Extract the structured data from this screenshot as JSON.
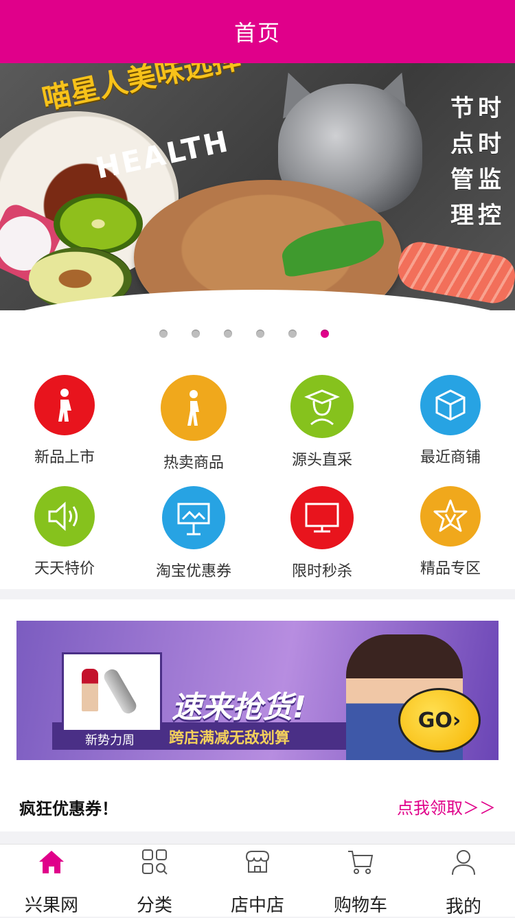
{
  "header": {
    "title": "首页"
  },
  "banner": {
    "headline": "喵星人美味选择",
    "badge": "HEALTH",
    "side_text": [
      "节时",
      "点时",
      "管监",
      "理控"
    ],
    "slide_count": 6,
    "active_slide_index": 5
  },
  "categories": [
    {
      "label": "新品上市",
      "icon": "walking-person-icon",
      "color": "#e8141d"
    },
    {
      "label": "热卖商品",
      "icon": "walking-person-icon",
      "color": "#f0a81c"
    },
    {
      "label": "源头直采",
      "icon": "graduate-icon",
      "color": "#86c21d"
    },
    {
      "label": "最近商铺",
      "icon": "box-icon",
      "color": "#27a3e3"
    },
    {
      "label": "天天特价",
      "icon": "speaker-icon",
      "color": "#86c21d"
    },
    {
      "label": "淘宝优惠券",
      "icon": "easel-icon",
      "color": "#27a3e3"
    },
    {
      "label": "限时秒杀",
      "icon": "monitor-icon",
      "color": "#e8141d"
    },
    {
      "label": "精品专区",
      "icon": "star-icon",
      "color": "#f0a81c"
    }
  ],
  "ad": {
    "headline": "速来抢货!",
    "subline": "跨店满减无敌划算",
    "small_label": "新势力周",
    "cta": "GO›"
  },
  "coupon": {
    "title": "疯狂优惠券！",
    "link": "点我领取＞＞"
  },
  "tabbar": {
    "items": [
      {
        "label": "兴果网",
        "icon": "home-icon",
        "active": true
      },
      {
        "label": "分类",
        "icon": "grid-icon",
        "active": false
      },
      {
        "label": "店中店",
        "icon": "store-icon",
        "active": false
      },
      {
        "label": "购物车",
        "icon": "cart-icon",
        "active": false
      },
      {
        "label": "我的",
        "icon": "user-icon",
        "active": false
      }
    ]
  },
  "colors": {
    "brand": "#e0008a"
  }
}
